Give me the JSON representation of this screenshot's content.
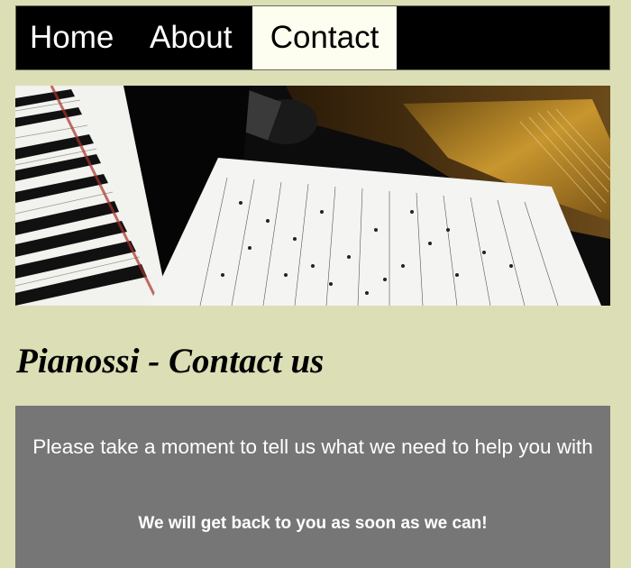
{
  "nav": {
    "items": [
      {
        "label": "Home",
        "active": false
      },
      {
        "label": "About",
        "active": false
      },
      {
        "label": "Contact",
        "active": true
      }
    ]
  },
  "hero": {
    "image": "piano-with-sheet-music-photo"
  },
  "main": {
    "title": "Pianossi - Contact us",
    "intro": "Please take a moment to tell us what we need to help you with",
    "note": "We will get back to you as soon as we can!"
  },
  "colors": {
    "page_background": "#dcdeb5",
    "nav_background": "#000000",
    "nav_active_background": "#fdfdf0",
    "panel_background": "#767676"
  }
}
